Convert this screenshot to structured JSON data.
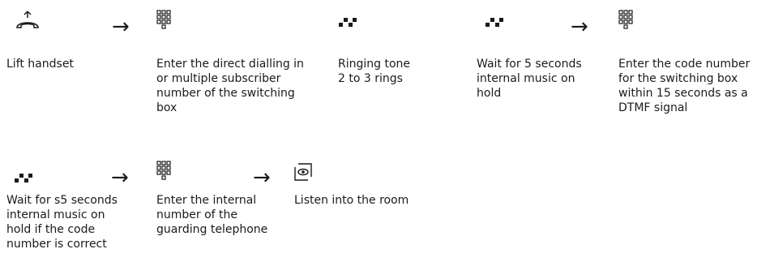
{
  "row1": [
    {
      "icon": "lift-handset-icon",
      "text": "Lift handset"
    },
    {
      "icon": "keypad-icon",
      "text": "Enter the direct dialling in\nor multiple subscriber\nnumber of the switching\nbox"
    },
    {
      "icon": "ringing-tone-icon",
      "text": "Ringing tone\n2 to 3 rings"
    },
    {
      "icon": "waiting-tone-icon",
      "text": "Wait for 5 seconds\ninternal music on\nhold"
    },
    {
      "icon": "keypad-icon",
      "text": "Enter the code number\nfor the switching box\nwithin 15 seconds as a\nDTMF signal"
    }
  ],
  "row2": [
    {
      "icon": "waiting-tone-icon",
      "text": "Wait for s5 seconds\ninternal music on\nhold if the code\nnumber is correct"
    },
    {
      "icon": "keypad-icon",
      "text": "Enter the internal\nnumber of the\nguarding telephone"
    },
    {
      "icon": "room-monitor-icon",
      "text": "Listen into the room"
    }
  ],
  "arrow_glyph": "→"
}
